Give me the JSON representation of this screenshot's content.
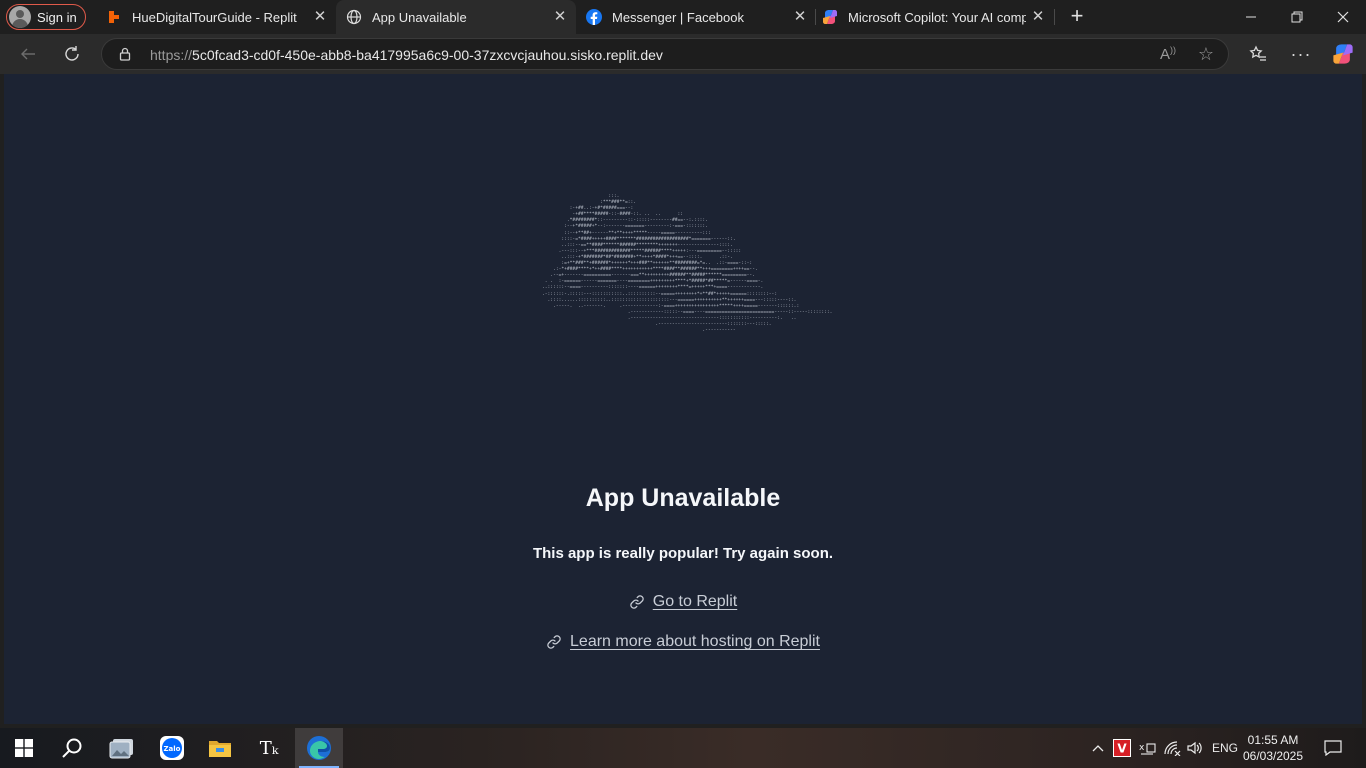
{
  "browser": {
    "sign_in_label": "Sign in",
    "tabs": [
      {
        "title": "HueDigitalTourGuide - Replit",
        "icon": "replit-icon"
      },
      {
        "title": "App Unavailable",
        "icon": "globe-icon"
      },
      {
        "title": "Messenger | Facebook",
        "icon": "facebook-icon"
      },
      {
        "title": "Microsoft Copilot: Your AI compar",
        "icon": "copilot-icon"
      }
    ],
    "url_prefix": "https://",
    "url_host": "5c0fcad3-cd0f-450e-abb8-ba417995a6c9-00-37zxcvcjauhou.sisko.replit.dev",
    "read_aloud_label": "A"
  },
  "page": {
    "heading": "App Unavailable",
    "subtitle": "This app is really popular! Try again soon.",
    "link1": "Go to Replit",
    "link2": "Learn more about hosting on Replit",
    "ascii_art": "                        :::.\n                     :***###**=::.\n          :-+##..:-+#*#####===--:\n           -+##****#####-::-####-::. ..  ..      ::\n         .*########*::---------::-:::::--------##==--:.::::.\n        :--+*#####+*--:-------=======---------:-===-:::::::.\n        ::--+**##+------**+**++++*****-----=====----------:::\n       ::::-=*####+++++####*******###################*=======------::.\n       ..:::--==**####******######********+++++++---------------::::.\n      .---:::--+***#############*****######****+++++:---=========--:::::\n       ..:::-+*#######*##*#######+**++++*####*+++==--::::.      .::-.\n       :=+**###**+######*++++++*+++###**++++++**########=*=..  .::-====-::-:\n    .:-*+####****+*++####****+++++++++++****####**######**+++========++++==--.\n   .--=+-------==========-------===**+++++++++######**#####******=========--.\n . .  :-======------=======----========+++++++++****+*#####*##*****=------====-.\n..::::::--====----------:::::::----======++++++++****=+++++***+====------------.\n.-::::::-.:::::---:::::::::::..::::::::::--=====++++++++*+**##*+++++======::::::::--:\n  .::::......::::::::::..:::::::::::::::::::::---======++++++++++**++++++====---:::::----::.\n    .-----.  ..-------.     .-------------:-====++++++++++++++++*****++++=====-------::::::.:\n                               .------------:::::--====----=========================-----::-----::::::::.\n                               .--------------------------------:::::::::::----------:.   ..\n                                         .-------------------------:::::::---:::::.\n                                                          .-----------"
  },
  "taskbar": {
    "apps": [
      "windows-start-icon",
      "search-icon",
      "photos-app-icon",
      "zalo-icon",
      "file-explorer-icon",
      "typing-app-icon",
      "edge-icon"
    ],
    "language": "ENG",
    "time": "01:55 AM",
    "date": "06/03/2025"
  }
}
